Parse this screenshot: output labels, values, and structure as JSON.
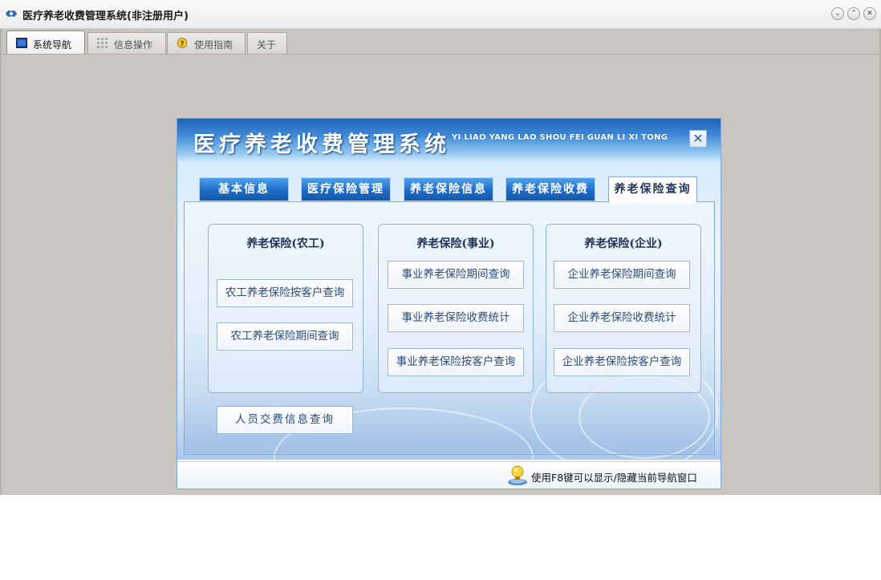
{
  "window": {
    "title": "医疗养老收费管理系统(非注册用户)",
    "controls": [
      "minimize",
      "maximize",
      "close"
    ]
  },
  "main_tabs": [
    {
      "label": "系统导航",
      "icon": "window-icon",
      "active": true
    },
    {
      "label": "信息操作",
      "icon": "grid-icon",
      "active": false
    },
    {
      "label": "使用指南",
      "icon": "help-icon",
      "active": false
    },
    {
      "label": "关于",
      "icon": "",
      "active": false
    }
  ],
  "panel": {
    "title": "医疗养老收费管理系统",
    "subtitle": "YI LIAO YANG LAO SHOU FEI GUAN LI XI TONG",
    "close_label": "✕"
  },
  "module_tabs": [
    {
      "label": "基本信息",
      "active": false
    },
    {
      "label": "医疗保险管理",
      "active": false
    },
    {
      "label": "养老保险信息",
      "active": false
    },
    {
      "label": "养老保险收费",
      "active": false
    },
    {
      "label": "养老保险查询",
      "active": true
    }
  ],
  "groups": [
    {
      "title": "养老保险(农工)",
      "buttons": [
        "农工养老保险按客户查询",
        "农工养老保险期间查询"
      ]
    },
    {
      "title": "养老保险(事业)",
      "buttons": [
        "事业养老保险期间查询",
        "事业养老保险收费统计",
        "事业养老保险按客户查询"
      ]
    },
    {
      "title": "养老保险(企业)",
      "buttons": [
        "企业养老保险期间查询",
        "企业养老保险收费统计",
        "企业养老保险按客户查询"
      ]
    }
  ],
  "extra_button": "人员交费信息查询",
  "footer": {
    "hint": "使用F8键可以显示/隐藏当前导航窗口",
    "icon": "lightbulb-icon"
  },
  "colors": {
    "accent": "#1e6cc8",
    "header_top": "#1f63b8",
    "workspace_bg": "#c9c5c0",
    "button_text": "#2a4d7b"
  }
}
